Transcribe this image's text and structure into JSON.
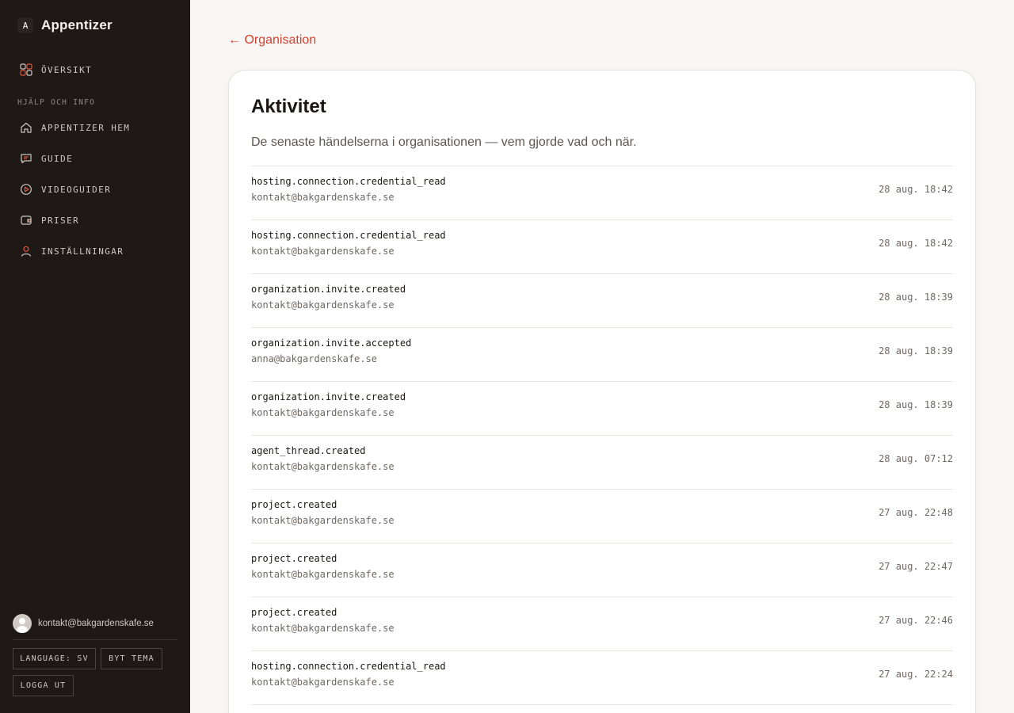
{
  "brand": {
    "mark": "A",
    "name": "Appentizer"
  },
  "nav": {
    "overview": {
      "label": "ÖVERSIKT",
      "icon": "grid-icon"
    },
    "section_label": "HJÄLP OCH INFO",
    "items": [
      {
        "label": "APPENTIZER HEM",
        "icon": "home-icon"
      },
      {
        "label": "GUIDE",
        "icon": "chat-icon"
      },
      {
        "label": "VIDEOGUIDER",
        "icon": "play-circle-icon"
      },
      {
        "label": "PRISER",
        "icon": "wallet-icon"
      },
      {
        "label": "INSTÄLLNINGAR",
        "icon": "user-icon"
      }
    ]
  },
  "user": {
    "email": "kontakt@bakgardenskafe.se"
  },
  "buttons": {
    "language": "LANGUAGE: SV",
    "theme": "BYT TEMA",
    "logout": "LOGGA UT"
  },
  "back_link": "← Organisation",
  "card": {
    "title": "Aktivitet",
    "subtitle": "De senaste händelserna i organisationen — vem gjorde vad och när."
  },
  "events": [
    {
      "event": "hosting.connection.credential_read",
      "actor": "kontakt@bakgardenskafe.se",
      "time": "28 aug. 18:42"
    },
    {
      "event": "hosting.connection.credential_read",
      "actor": "kontakt@bakgardenskafe.se",
      "time": "28 aug. 18:42"
    },
    {
      "event": "organization.invite.created",
      "actor": "kontakt@bakgardenskafe.se",
      "time": "28 aug. 18:39"
    },
    {
      "event": "organization.invite.accepted",
      "actor": "anna@bakgardenskafe.se",
      "time": "28 aug. 18:39"
    },
    {
      "event": "organization.invite.created",
      "actor": "kontakt@bakgardenskafe.se",
      "time": "28 aug. 18:39"
    },
    {
      "event": "agent_thread.created",
      "actor": "kontakt@bakgardenskafe.se",
      "time": "28 aug. 07:12"
    },
    {
      "event": "project.created",
      "actor": "kontakt@bakgardenskafe.se",
      "time": "27 aug. 22:48"
    },
    {
      "event": "project.created",
      "actor": "kontakt@bakgardenskafe.se",
      "time": "27 aug. 22:47"
    },
    {
      "event": "project.created",
      "actor": "kontakt@bakgardenskafe.se",
      "time": "27 aug. 22:46"
    },
    {
      "event": "hosting.connection.credential_read",
      "actor": "kontakt@bakgardenskafe.se",
      "time": "27 aug. 22:24"
    }
  ],
  "colors": {
    "accent": "#d6402b",
    "sidebar_bg": "#1e1916",
    "page_bg": "#f8f7f5"
  }
}
